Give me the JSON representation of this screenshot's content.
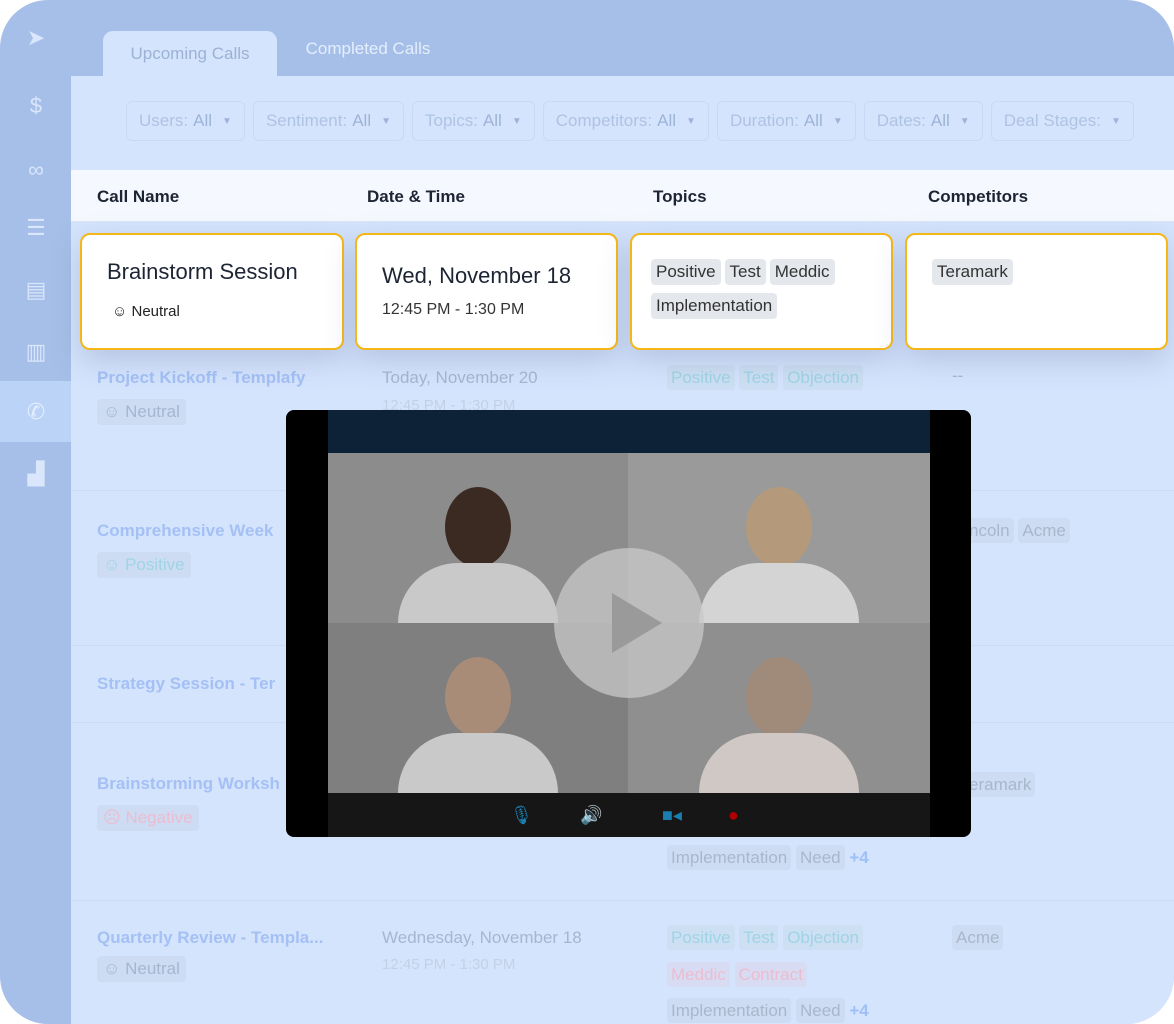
{
  "sidebar": {
    "items": [
      {
        "icon": "send-icon"
      },
      {
        "icon": "dollar-icon"
      },
      {
        "icon": "binoculars-icon"
      },
      {
        "icon": "funnel-icon"
      },
      {
        "icon": "chart-card-icon"
      },
      {
        "icon": "building-icon"
      },
      {
        "icon": "phone-call-icon",
        "active": true
      },
      {
        "icon": "bar-chart-icon"
      }
    ]
  },
  "tabs": [
    {
      "label": "Upcoming Calls",
      "active": true
    },
    {
      "label": "Completed Calls"
    }
  ],
  "filters": [
    {
      "label": "Users:",
      "value": "All"
    },
    {
      "label": "Sentiment:",
      "value": "All"
    },
    {
      "label": "Topics:",
      "value": "All"
    },
    {
      "label": "Competitors:",
      "value": "All"
    },
    {
      "label": "Duration:",
      "value": "All"
    },
    {
      "label": "Dates:",
      "value": "All"
    },
    {
      "label": "Deal Stages:",
      "value": ""
    }
  ],
  "columns": [
    "Call Name",
    "Date & Time",
    "Topics",
    "Competitors"
  ],
  "highlight": {
    "name": "Brainstorm Session",
    "sentiment": "Neutral",
    "date": "Wed, November 18",
    "time": "12:45 PM - 1:30 PM",
    "topics": [
      "Positive",
      "Test",
      "Meddic",
      "Implementation"
    ],
    "competitors": [
      "Teramark"
    ]
  },
  "rows": [
    {
      "name": "Project Kickoff - Templafy",
      "sentiment": "Neutral",
      "date": "Today, November 20",
      "time": "12:45 PM - 1:30 PM",
      "topics": [
        "Positive",
        "Test",
        "Objection"
      ],
      "competitors": "--"
    },
    {
      "name": "Comprehensive Week",
      "sentiment": "Positive",
      "competitors": [
        "ncoln",
        "Acme"
      ]
    },
    {
      "name": "Strategy Session - Ter"
    },
    {
      "name": "Brainstorming Worksh",
      "sentiment": "Negative",
      "competitors": [
        "eramark"
      ],
      "topics": [
        "Implementation",
        "Need"
      ],
      "more": "+4"
    },
    {
      "name": "Quarterly Review - Templa...",
      "sentiment": "Neutral",
      "date": "Wednesday, November 18",
      "time": "12:45 PM - 1:30 PM",
      "topics": [
        "Positive",
        "Test",
        "Objection",
        "Meddic",
        "Contract",
        "Implementation",
        "Need"
      ],
      "more": "+4",
      "competitors": [
        "Acme"
      ]
    }
  ],
  "video": {
    "controls": [
      "microphone-icon",
      "speaker-icon",
      "camera-icon",
      "hang-up-icon"
    ],
    "accent": "#1a7fb0",
    "hangup": "#b00000"
  },
  "colors": {
    "highlight_border": "#f5b718",
    "frame": "#a6bfe8",
    "main": "#d5e4fd"
  }
}
